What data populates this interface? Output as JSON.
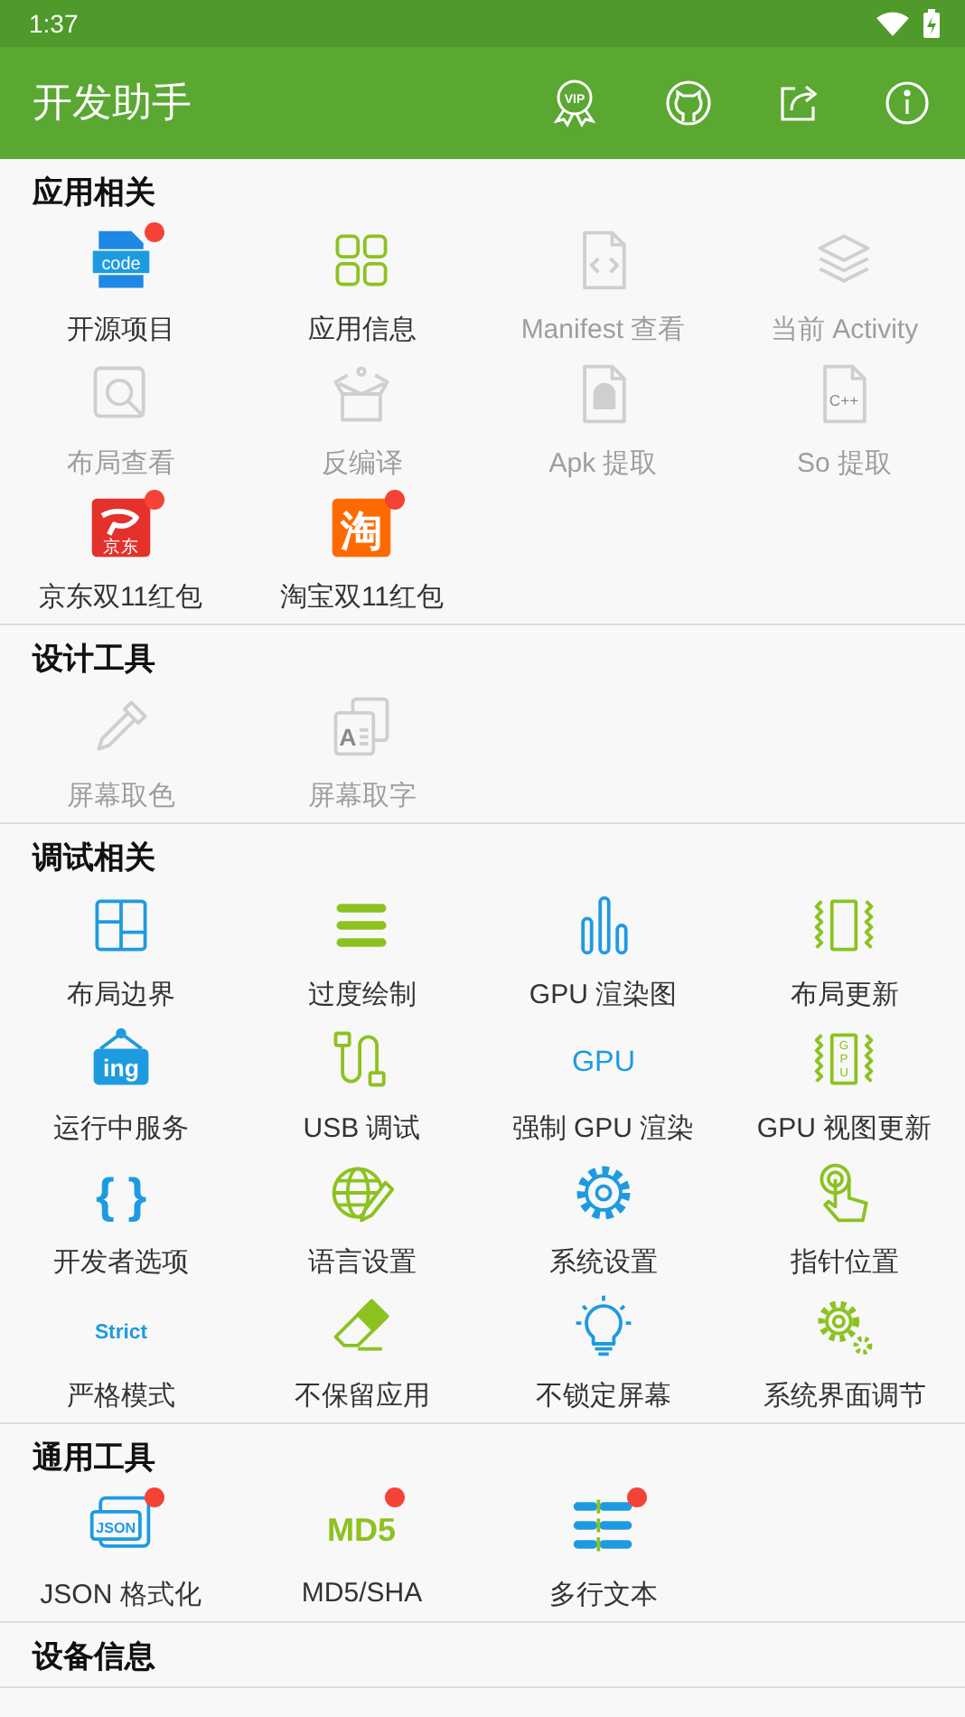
{
  "status_bar": {
    "time": "1:37"
  },
  "app_bar": {
    "title": "开发助手",
    "vip_label": "VIP"
  },
  "sections": [
    {
      "title": "应用相关",
      "items": [
        {
          "label": "开源项目",
          "kind": "code-file",
          "icon_text": "code",
          "disabled": false,
          "badge": true
        },
        {
          "label": "应用信息",
          "kind": "grid",
          "disabled": false,
          "badge": false
        },
        {
          "label": "Manifest 查看",
          "kind": "file-code",
          "disabled": true,
          "badge": false
        },
        {
          "label": "当前 Activity",
          "kind": "layers",
          "disabled": true,
          "badge": false
        },
        {
          "label": "布局查看",
          "kind": "search-frame",
          "disabled": true,
          "badge": false
        },
        {
          "label": "反编译",
          "kind": "box",
          "disabled": true,
          "badge": false
        },
        {
          "label": "Apk 提取",
          "kind": "android-file",
          "disabled": true,
          "badge": false
        },
        {
          "label": "So 提取",
          "kind": "cpp-file",
          "icon_text": "C++",
          "disabled": true,
          "badge": false
        },
        {
          "label": "京东双11红包",
          "kind": "jd",
          "icon_text": "京东",
          "disabled": false,
          "badge": true
        },
        {
          "label": "淘宝双11红包",
          "kind": "taobao",
          "icon_text": "淘",
          "disabled": false,
          "badge": true
        }
      ]
    },
    {
      "title": "设计工具",
      "items": [
        {
          "label": "屏幕取色",
          "kind": "eyedropper",
          "disabled": true,
          "badge": false
        },
        {
          "label": "屏幕取字",
          "kind": "text-doc",
          "icon_text": "A",
          "disabled": true,
          "badge": false
        }
      ]
    },
    {
      "title": "调试相关",
      "items": [
        {
          "label": "布局边界",
          "kind": "layout",
          "disabled": false,
          "badge": false
        },
        {
          "label": "过度绘制",
          "kind": "lines",
          "disabled": false,
          "badge": false
        },
        {
          "label": "GPU 渲染图",
          "kind": "bars",
          "disabled": false,
          "badge": false
        },
        {
          "label": "布局更新",
          "kind": "vibrate",
          "disabled": false,
          "badge": false
        },
        {
          "label": "运行中服务",
          "kind": "sign",
          "icon_text": "ing",
          "disabled": false,
          "badge": false
        },
        {
          "label": "USB 调试",
          "kind": "usb",
          "disabled": false,
          "badge": false
        },
        {
          "label": "强制 GPU 渲染",
          "kind": "word",
          "icon_text": "GPU",
          "disabled": false,
          "badge": false
        },
        {
          "label": "GPU 视图更新",
          "kind": "vibrate-text",
          "icon_text": "GPU",
          "disabled": false,
          "badge": false
        },
        {
          "label": "开发者选项",
          "kind": "braces",
          "icon_text": "{ }",
          "disabled": false,
          "badge": false
        },
        {
          "label": "语言设置",
          "kind": "globe",
          "disabled": false,
          "badge": false
        },
        {
          "label": "系统设置",
          "kind": "gear",
          "disabled": false,
          "badge": false
        },
        {
          "label": "指针位置",
          "kind": "tap",
          "disabled": false,
          "badge": false
        },
        {
          "label": "严格模式",
          "kind": "word",
          "icon_text": "Strict",
          "disabled": false,
          "badge": false
        },
        {
          "label": "不保留应用",
          "kind": "eraser",
          "disabled": false,
          "badge": false
        },
        {
          "label": "不锁定屏幕",
          "kind": "bulb",
          "disabled": false,
          "badge": false
        },
        {
          "label": "系统界面调节",
          "kind": "gears",
          "disabled": false,
          "badge": false
        }
      ]
    },
    {
      "title": "通用工具",
      "items": [
        {
          "label": "JSON 格式化",
          "kind": "json",
          "icon_text": "JSON",
          "disabled": false,
          "badge": true
        },
        {
          "label": "MD5/SHA",
          "kind": "word-green",
          "icon_text": "MD5",
          "disabled": false,
          "badge": true
        },
        {
          "label": "多行文本",
          "kind": "list",
          "disabled": false,
          "badge": true
        }
      ]
    },
    {
      "title": "设备信息"
    }
  ]
}
